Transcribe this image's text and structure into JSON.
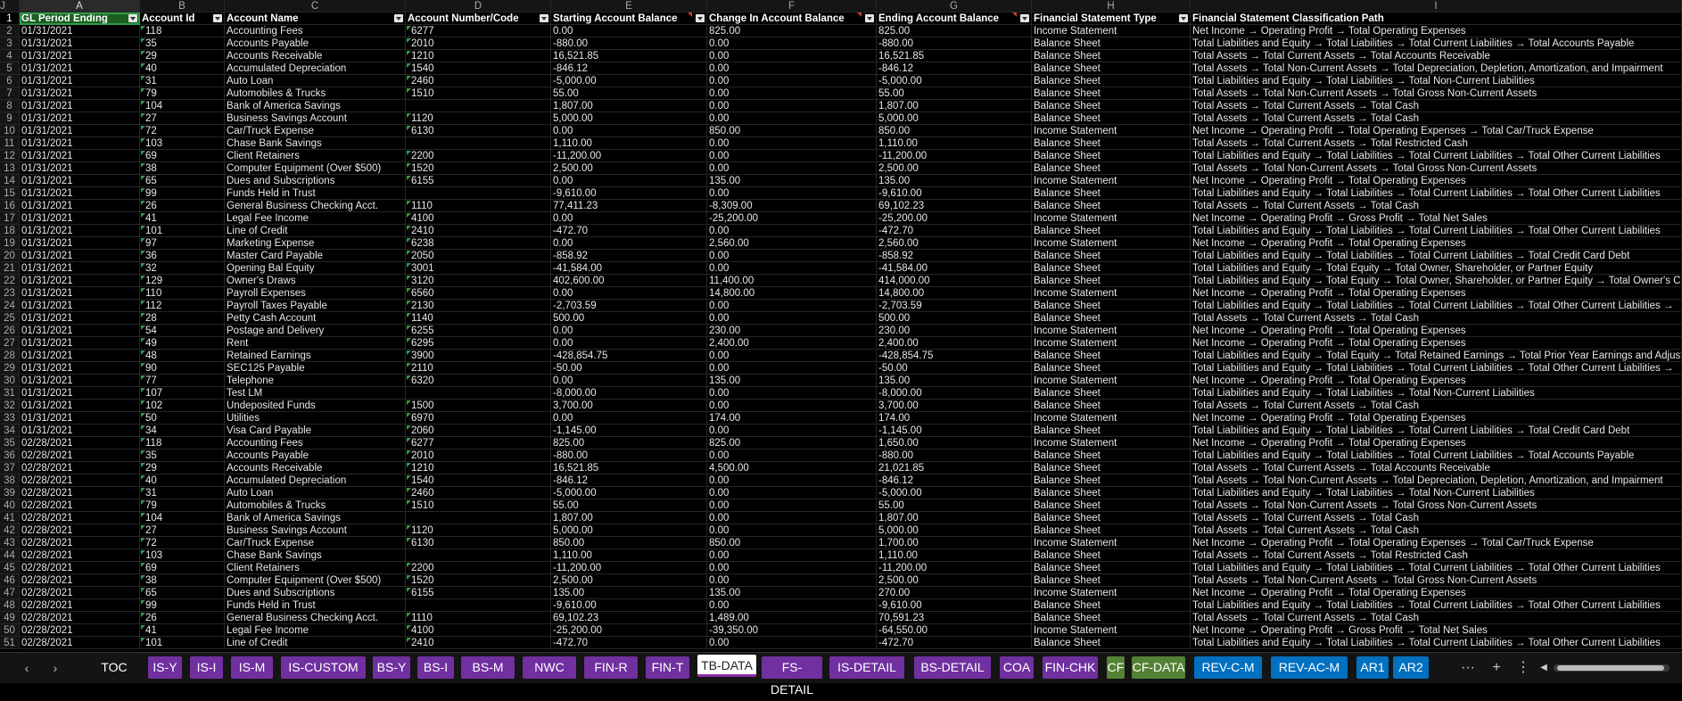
{
  "column_letters": [
    "A",
    "B",
    "C",
    "D",
    "E",
    "F",
    "G",
    "H",
    "I",
    "J"
  ],
  "headers": [
    "GL Period Ending",
    "Account Id",
    "Account Name",
    "Account Number/Code",
    "Starting Account Balance",
    "Change In Account Balance",
    "Ending Account Balance",
    "Financial Statement Type",
    "Financial Statement Classification Path"
  ],
  "rows": [
    [
      "01/31/2021",
      "118",
      "Accounting Fees",
      "6277",
      "0.00",
      "825.00",
      "825.00",
      "Income Statement",
      "Net Income → Operating Profit → Total Operating Expenses"
    ],
    [
      "01/31/2021",
      "35",
      "Accounts Payable",
      "2010",
      "-880.00",
      "0.00",
      "-880.00",
      "Balance Sheet",
      "Total Liabilities and Equity → Total Liabilities → Total Current Liabilities → Total Accounts Payable"
    ],
    [
      "01/31/2021",
      "29",
      "Accounts Receivable",
      "1210",
      "16,521.85",
      "0.00",
      "16,521.85",
      "Balance Sheet",
      "Total Assets → Total Current Assets → Total Accounts Receivable"
    ],
    [
      "01/31/2021",
      "40",
      "Accumulated Depreciation",
      "1540",
      "-846.12",
      "0.00",
      "-846.12",
      "Balance Sheet",
      "Total Assets → Total Non-Current Assets → Total Depreciation, Depletion, Amortization, and Impairment"
    ],
    [
      "01/31/2021",
      "31",
      "Auto Loan",
      "2460",
      "-5,000.00",
      "0.00",
      "-5,000.00",
      "Balance Sheet",
      "Total Liabilities and Equity → Total Liabilities → Total Non-Current Liabilities"
    ],
    [
      "01/31/2021",
      "79",
      "Automobiles & Trucks",
      "1510",
      "55.00",
      "0.00",
      "55.00",
      "Balance Sheet",
      "Total Assets → Total Non-Current Assets → Total Gross Non-Current Assets"
    ],
    [
      "01/31/2021",
      "104",
      "Bank of America Savings",
      "",
      "1,807.00",
      "0.00",
      "1,807.00",
      "Balance Sheet",
      "Total Assets → Total Current Assets → Total Cash"
    ],
    [
      "01/31/2021",
      "27",
      "Business Savings Account",
      "1120",
      "5,000.00",
      "0.00",
      "5,000.00",
      "Balance Sheet",
      "Total Assets → Total Current Assets → Total Cash"
    ],
    [
      "01/31/2021",
      "72",
      "Car/Truck Expense",
      "6130",
      "0.00",
      "850.00",
      "850.00",
      "Income Statement",
      "Net Income → Operating Profit → Total Operating Expenses → Total Car/Truck Expense"
    ],
    [
      "01/31/2021",
      "103",
      "Chase Bank Savings",
      "",
      "1,110.00",
      "0.00",
      "1,110.00",
      "Balance Sheet",
      "Total Assets → Total Current Assets → Total Restricted Cash"
    ],
    [
      "01/31/2021",
      "69",
      "Client Retainers",
      "2200",
      "-11,200.00",
      "0.00",
      "-11,200.00",
      "Balance Sheet",
      "Total Liabilities and Equity → Total Liabilities → Total Current Liabilities → Total Other Current Liabilities"
    ],
    [
      "01/31/2021",
      "38",
      "Computer Equipment (Over $500)",
      "1520",
      "2,500.00",
      "0.00",
      "2,500.00",
      "Balance Sheet",
      "Total Assets → Total Non-Current Assets → Total Gross Non-Current Assets"
    ],
    [
      "01/31/2021",
      "65",
      "Dues and Subscriptions",
      "6155",
      "0.00",
      "135.00",
      "135.00",
      "Income Statement",
      "Net Income → Operating Profit → Total Operating Expenses"
    ],
    [
      "01/31/2021",
      "99",
      "Funds Held in Trust",
      "",
      "-9,610.00",
      "0.00",
      "-9,610.00",
      "Balance Sheet",
      "Total Liabilities and Equity → Total Liabilities → Total Current Liabilities → Total Other Current Liabilities"
    ],
    [
      "01/31/2021",
      "26",
      "General Business Checking Acct.",
      "1110",
      "77,411.23",
      "-8,309.00",
      "69,102.23",
      "Balance Sheet",
      "Total Assets → Total Current Assets → Total Cash"
    ],
    [
      "01/31/2021",
      "41",
      "Legal Fee Income",
      "4100",
      "0.00",
      "-25,200.00",
      "-25,200.00",
      "Income Statement",
      "Net Income → Operating Profit → Gross Profit → Total Net Sales"
    ],
    [
      "01/31/2021",
      "101",
      "Line of Credit",
      "2410",
      "-472.70",
      "0.00",
      "-472.70",
      "Balance Sheet",
      "Total Liabilities and Equity → Total Liabilities → Total Current Liabilities → Total Other Current Liabilities"
    ],
    [
      "01/31/2021",
      "97",
      "Marketing Expense",
      "6238",
      "0.00",
      "2,560.00",
      "2,560.00",
      "Income Statement",
      "Net Income → Operating Profit → Total Operating Expenses"
    ],
    [
      "01/31/2021",
      "36",
      "Master Card Payable",
      "2050",
      "-858.92",
      "0.00",
      "-858.92",
      "Balance Sheet",
      "Total Liabilities and Equity → Total Liabilities → Total Current Liabilities → Total Credit Card Debt"
    ],
    [
      "01/31/2021",
      "32",
      "Opening Bal Equity",
      "3001",
      "-41,584.00",
      "0.00",
      "-41,584.00",
      "Balance Sheet",
      "Total Liabilities and Equity → Total Equity → Total Owner, Shareholder, or Partner Equity"
    ],
    [
      "01/31/2021",
      "129",
      "Owner's  Draws",
      "3120",
      "402,600.00",
      "11,400.00",
      "414,000.00",
      "Balance Sheet",
      "Total Liabilities and Equity → Total Equity → Total Owner, Shareholder, or Partner Equity → Total Owner's Cap"
    ],
    [
      "01/31/2021",
      "110",
      "Payroll Expenses",
      "6560",
      "0.00",
      "14,800.00",
      "14,800.00",
      "Income Statement",
      "Net Income → Operating Profit → Total Operating Expenses"
    ],
    [
      "01/31/2021",
      "112",
      "Payroll Taxes Payable",
      "2130",
      "-2,703.59",
      "0.00",
      "-2,703.59",
      "Balance Sheet",
      "Total Liabilities and Equity → Total Liabilities → Total Current Liabilities → Total Other Current Liabilities →"
    ],
    [
      "01/31/2021",
      "28",
      "Petty Cash Account",
      "1140",
      "500.00",
      "0.00",
      "500.00",
      "Balance Sheet",
      "Total Assets → Total Current Assets → Total Cash"
    ],
    [
      "01/31/2021",
      "54",
      "Postage and Delivery",
      "6255",
      "0.00",
      "230.00",
      "230.00",
      "Income Statement",
      "Net Income → Operating Profit → Total Operating Expenses"
    ],
    [
      "01/31/2021",
      "49",
      "Rent",
      "6295",
      "0.00",
      "2,400.00",
      "2,400.00",
      "Income Statement",
      "Net Income → Operating Profit → Total Operating Expenses"
    ],
    [
      "01/31/2021",
      "48",
      "Retained Earnings",
      "3900",
      "-428,854.75",
      "0.00",
      "-428,854.75",
      "Balance Sheet",
      "Total Liabilities and Equity → Total Equity → Total Retained Earnings → Total Prior Year Earnings and Adjustm"
    ],
    [
      "01/31/2021",
      "90",
      "SEC125 Payable",
      "2110",
      "-50.00",
      "0.00",
      "-50.00",
      "Balance Sheet",
      "Total Liabilities and Equity → Total Liabilities → Total Current Liabilities → Total Other Current Liabilities →"
    ],
    [
      "01/31/2021",
      "77",
      "Telephone",
      "6320",
      "0.00",
      "135.00",
      "135.00",
      "Income Statement",
      "Net Income → Operating Profit → Total Operating Expenses"
    ],
    [
      "01/31/2021",
      "107",
      "Test LM",
      "",
      "-8,000.00",
      "0.00",
      "-8,000.00",
      "Balance Sheet",
      "Total Liabilities and Equity → Total Liabilities → Total Non-Current Liabilities"
    ],
    [
      "01/31/2021",
      "102",
      "Undeposited Funds",
      "1500",
      "3,700.00",
      "0.00",
      "3,700.00",
      "Balance Sheet",
      "Total Assets → Total Current Assets → Total Cash"
    ],
    [
      "01/31/2021",
      "50",
      "Utilities",
      "6970",
      "0.00",
      "174.00",
      "174.00",
      "Income Statement",
      "Net Income → Operating Profit → Total Operating Expenses"
    ],
    [
      "01/31/2021",
      "34",
      "Visa Card Payable",
      "2060",
      "-1,145.00",
      "0.00",
      "-1,145.00",
      "Balance Sheet",
      "Total Liabilities and Equity → Total Liabilities → Total Current Liabilities → Total Credit Card Debt"
    ],
    [
      "02/28/2021",
      "118",
      "Accounting Fees",
      "6277",
      "825.00",
      "825.00",
      "1,650.00",
      "Income Statement",
      "Net Income → Operating Profit → Total Operating Expenses"
    ],
    [
      "02/28/2021",
      "35",
      "Accounts Payable",
      "2010",
      "-880.00",
      "0.00",
      "-880.00",
      "Balance Sheet",
      "Total Liabilities and Equity → Total Liabilities → Total Current Liabilities → Total Accounts Payable"
    ],
    [
      "02/28/2021",
      "29",
      "Accounts Receivable",
      "1210",
      "16,521.85",
      "4,500.00",
      "21,021.85",
      "Balance Sheet",
      "Total Assets → Total Current Assets → Total Accounts Receivable"
    ],
    [
      "02/28/2021",
      "40",
      "Accumulated Depreciation",
      "1540",
      "-846.12",
      "0.00",
      "-846.12",
      "Balance Sheet",
      "Total Assets → Total Non-Current Assets → Total Depreciation, Depletion, Amortization, and Impairment"
    ],
    [
      "02/28/2021",
      "31",
      "Auto Loan",
      "2460",
      "-5,000.00",
      "0.00",
      "-5,000.00",
      "Balance Sheet",
      "Total Liabilities and Equity → Total Liabilities → Total Non-Current Liabilities"
    ],
    [
      "02/28/2021",
      "79",
      "Automobiles & Trucks",
      "1510",
      "55.00",
      "0.00",
      "55.00",
      "Balance Sheet",
      "Total Assets → Total Non-Current Assets → Total Gross Non-Current Assets"
    ],
    [
      "02/28/2021",
      "104",
      "Bank of America Savings",
      "",
      "1,807.00",
      "0.00",
      "1,807.00",
      "Balance Sheet",
      "Total Assets → Total Current Assets → Total Cash"
    ],
    [
      "02/28/2021",
      "27",
      "Business Savings Account",
      "1120",
      "5,000.00",
      "0.00",
      "5,000.00",
      "Balance Sheet",
      "Total Assets → Total Current Assets → Total Cash"
    ],
    [
      "02/28/2021",
      "72",
      "Car/Truck Expense",
      "6130",
      "850.00",
      "850.00",
      "1,700.00",
      "Income Statement",
      "Net Income → Operating Profit → Total Operating Expenses → Total Car/Truck Expense"
    ],
    [
      "02/28/2021",
      "103",
      "Chase Bank Savings",
      "",
      "1,110.00",
      "0.00",
      "1,110.00",
      "Balance Sheet",
      "Total Assets → Total Current Assets → Total Restricted Cash"
    ],
    [
      "02/28/2021",
      "69",
      "Client Retainers",
      "2200",
      "-11,200.00",
      "0.00",
      "-11,200.00",
      "Balance Sheet",
      "Total Liabilities and Equity → Total Liabilities → Total Current Liabilities → Total Other Current Liabilities"
    ],
    [
      "02/28/2021",
      "38",
      "Computer Equipment (Over $500)",
      "1520",
      "2,500.00",
      "0.00",
      "2,500.00",
      "Balance Sheet",
      "Total Assets → Total Non-Current Assets → Total Gross Non-Current Assets"
    ],
    [
      "02/28/2021",
      "65",
      "Dues and Subscriptions",
      "6155",
      "135.00",
      "135.00",
      "270.00",
      "Income Statement",
      "Net Income → Operating Profit → Total Operating Expenses"
    ],
    [
      "02/28/2021",
      "99",
      "Funds Held in Trust",
      "",
      "-9,610.00",
      "0.00",
      "-9,610.00",
      "Balance Sheet",
      "Total Liabilities and Equity → Total Liabilities → Total Current Liabilities → Total Other Current Liabilities"
    ],
    [
      "02/28/2021",
      "26",
      "General Business Checking Acct.",
      "1110",
      "69,102.23",
      "1,489.00",
      "70,591.23",
      "Balance Sheet",
      "Total Assets → Total Current Assets → Total Cash"
    ],
    [
      "02/28/2021",
      "41",
      "Legal Fee Income",
      "4100",
      "-25,200.00",
      "-39,350.00",
      "-64,550.00",
      "Income Statement",
      "Net Income → Operating Profit → Gross Profit → Total Net Sales"
    ],
    [
      "02/28/2021",
      "101",
      "Line of Credit",
      "2410",
      "-472.70",
      "0.00",
      "-472.70",
      "Balance Sheet",
      "Total Liabilities and Equity → Total Liabilities → Total Current Liabilities → Total Other Current Liabilities"
    ]
  ],
  "tabs": [
    {
      "label": "TOC",
      "color": "#141414"
    },
    {
      "label": "IS-Y",
      "color": "#7030a0"
    },
    {
      "label": "IS-I",
      "color": "#7030a0"
    },
    {
      "label": "IS-M",
      "color": "#7030a0"
    },
    {
      "label": "IS-CUSTOM",
      "color": "#7030a0"
    },
    {
      "label": "BS-Y",
      "color": "#7030a0"
    },
    {
      "label": "BS-I",
      "color": "#7030a0"
    },
    {
      "label": "BS-M",
      "color": "#7030a0"
    },
    {
      "label": "NWC",
      "color": "#7030a0"
    },
    {
      "label": "FIN-R",
      "color": "#7030a0"
    },
    {
      "label": "FIN-T",
      "color": "#7030a0"
    },
    {
      "label": "TB-DATA",
      "color": "#ffffff",
      "active": true
    },
    {
      "label": "FS-DETAIL",
      "color": "#7030a0"
    },
    {
      "label": "IS-DETAIL",
      "color": "#7030a0"
    },
    {
      "label": "BS-DETAIL",
      "color": "#7030a0"
    },
    {
      "label": "COA",
      "color": "#7030a0"
    },
    {
      "label": "FIN-CHK",
      "color": "#7030a0"
    },
    {
      "label": "CF",
      "color": "#548235"
    },
    {
      "label": "CF-DATA",
      "color": "#548235"
    },
    {
      "label": "REV-C-M",
      "color": "#0070c0"
    },
    {
      "label": "REV-AC-M",
      "color": "#0070c0"
    },
    {
      "label": "AR1",
      "color": "#0070c0"
    },
    {
      "label": "AR2",
      "color": "#0070c0"
    }
  ],
  "controls": {
    "more": "···",
    "add": "+",
    "menu": "⋮",
    "prev": "‹",
    "next": "›",
    "scroll_left": "◀"
  }
}
